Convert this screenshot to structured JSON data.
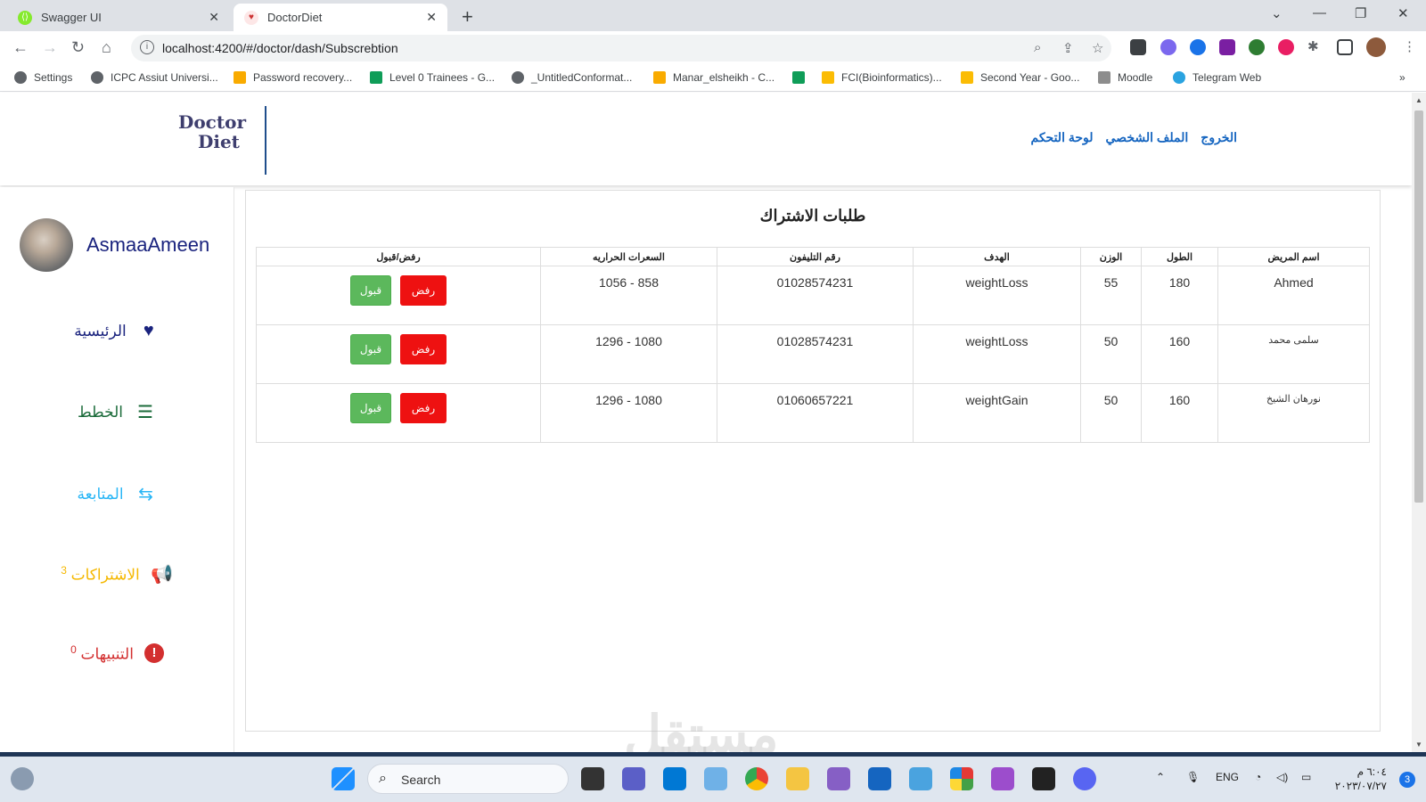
{
  "browser": {
    "tabs": [
      {
        "title": "Swagger UI",
        "active": false
      },
      {
        "title": "DoctorDiet",
        "active": true
      }
    ],
    "url": "localhost:4200/#/doctor/dash/Subscrebtion",
    "bookmarks": [
      "Settings",
      "ICPC Assiut Universi...",
      "Password recovery...",
      "Level 0 Trainees - G...",
      "_UntitledConformat...",
      "Manar_elsheikh - C...",
      "FCI(Bioinformatics)...",
      "Second Year - Goo...",
      "Moodle",
      "Telegram Web"
    ]
  },
  "header": {
    "logo_line1": "Doctor",
    "logo_line2": "Diet",
    "nav": [
      "الخروج",
      "الملف الشخصي",
      "لوحة التحكم"
    ]
  },
  "sidebar": {
    "username": "AsmaaAmeen",
    "items": [
      {
        "label": "الرئيسية",
        "icon": "heart-pulse-icon",
        "color": "#1a237e"
      },
      {
        "label": "الخطط",
        "icon": "list-check-icon",
        "color": "#1b6b3a"
      },
      {
        "label": "المتابعة",
        "icon": "people-arrows-icon",
        "color": "#29b6f6"
      },
      {
        "label": "الاشتراكات",
        "count": "3",
        "icon": "megaphone-icon",
        "color": "#f5b800"
      },
      {
        "label": "التنبيهات",
        "count": "0",
        "icon": "alert-circle-icon",
        "color": "#d32f2f"
      }
    ]
  },
  "main": {
    "title": "طلبات الاشتراك",
    "columns": [
      "اسم المريض",
      "الطول",
      "الوزن",
      "الهدف",
      "رقم التليفون",
      "السعرات الحراريه",
      "رفض/قبول"
    ],
    "rows": [
      {
        "name": "Ahmed",
        "height": "180",
        "weight": "55",
        "goal": "weightLoss",
        "phone": "01028574231",
        "calories": "858 - 1056"
      },
      {
        "name": "سلمى محمد",
        "height": "160",
        "weight": "50",
        "goal": "weightLoss",
        "phone": "01028574231",
        "calories": "1080 - 1296"
      },
      {
        "name": "نورهان الشيخ",
        "height": "160",
        "weight": "50",
        "goal": "weightGain",
        "phone": "01060657221",
        "calories": "1080 - 1296"
      }
    ],
    "reject_label": "رفض",
    "accept_label": "قبول"
  },
  "taskbar": {
    "search_placeholder": "Search",
    "lang": "ENG",
    "time": "٦:٠٤ م",
    "date": "٢٠٢٣/٠٧/٢٧",
    "notification_count": "3"
  },
  "watermark": "مستقل"
}
